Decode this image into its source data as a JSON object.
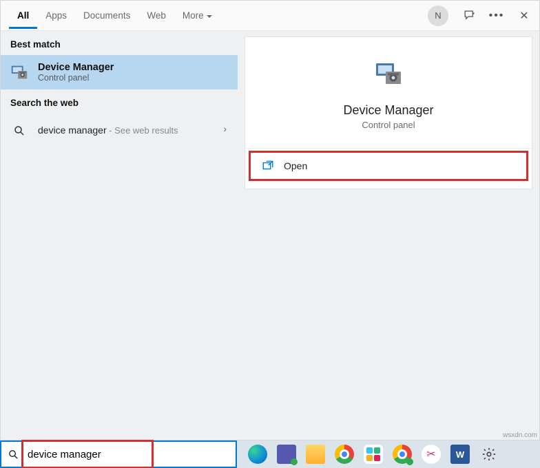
{
  "header": {
    "tabs": {
      "all": "All",
      "apps": "Apps",
      "docs": "Documents",
      "web": "Web",
      "more": "More"
    },
    "avatar_initial": "N"
  },
  "left": {
    "best_match": "Best match",
    "result": {
      "title": "Device Manager",
      "subtitle": "Control panel"
    },
    "search_web": "Search the web",
    "web_query": "device manager",
    "web_hint": " - See web results"
  },
  "detail": {
    "title": "Device Manager",
    "subtitle": "Control panel",
    "open_label": "Open"
  },
  "search": {
    "value": "device manager"
  },
  "watermark": "wsxdn.com"
}
